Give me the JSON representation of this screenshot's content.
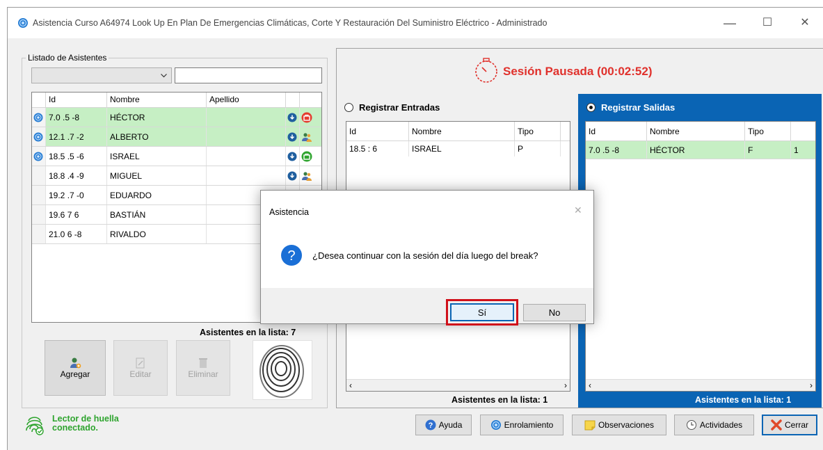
{
  "window": {
    "title": "Asistencia Curso A64974 Look Up En Plan De Emergencias Climáticas, Corte Y Restauración Del Suministro Eléctrico - Administrado",
    "minimize": "—",
    "maximize": "☐",
    "close": "✕"
  },
  "left_panel": {
    "group_title": "Listado de Asistentes",
    "combo_value": "",
    "search_value": "",
    "columns": [
      "Id",
      "Nombre",
      "Apellido"
    ],
    "rows": [
      {
        "id": "7.0  .5  -8",
        "nombre": "HÉCTOR",
        "apellido": "",
        "highlight": true,
        "status": "exit"
      },
      {
        "id": "12.1  .7  -2",
        "nombre": "ALBERTO",
        "apellido": "",
        "highlight": true,
        "status": "user"
      },
      {
        "id": "18.5  .5  -6",
        "nombre": "ISRAEL",
        "apellido": "",
        "highlight": false,
        "status": "enter"
      },
      {
        "id": "18.8  .4  -9",
        "nombre": "MIGUEL",
        "apellido": "",
        "highlight": false,
        "status": "user"
      },
      {
        "id": "19.2  .7  -0",
        "nombre": "EDUARDO",
        "apellido": "",
        "highlight": false,
        "status": "user"
      },
      {
        "id": "19.6  7  6",
        "nombre": "BASTIÁN",
        "apellido": "",
        "highlight": false,
        "status": "user"
      },
      {
        "id": "21.0  6  -8",
        "nombre": "RIVALDO",
        "apellido": "",
        "highlight": false,
        "status": "user"
      }
    ],
    "count_label": "Asistentes en la lista: 7",
    "buttons": {
      "add": "Agregar",
      "edit": "Editar",
      "delete": "Eliminar"
    }
  },
  "session": {
    "status": "Sesión Pausada (00:02:52)",
    "status_color": "#e0312c"
  },
  "entries": {
    "label": "Registrar Entradas",
    "columns": [
      "Id",
      "Nombre",
      "Tipo"
    ],
    "rows": [
      {
        "id": "18.5  :  6",
        "nombre": "ISRAEL",
        "tipo": "P"
      }
    ],
    "count_label": "Asistentes en la lista: 1"
  },
  "exits": {
    "label": "Registrar Salidas",
    "columns": [
      "Id",
      "Nombre",
      "Tipo"
    ],
    "rows": [
      {
        "id": "7.0  .5  -8",
        "nombre": "HÉCTOR",
        "tipo": "F",
        "extra": "1"
      }
    ],
    "count_label": "Asistentes en la lista: 1",
    "accent": "#0a64b4"
  },
  "dialog": {
    "title": "Asistencia",
    "message": "¿Desea continuar con la sesión del día luego del break?",
    "yes": "Sí",
    "no": "No"
  },
  "footer": {
    "reader_status": "Lector de huella conectado.",
    "buttons": {
      "help": "Ayuda",
      "enroll": "Enrolamiento",
      "notes": "Observaciones",
      "activities": "Actividades",
      "close": "Cerrar"
    }
  }
}
